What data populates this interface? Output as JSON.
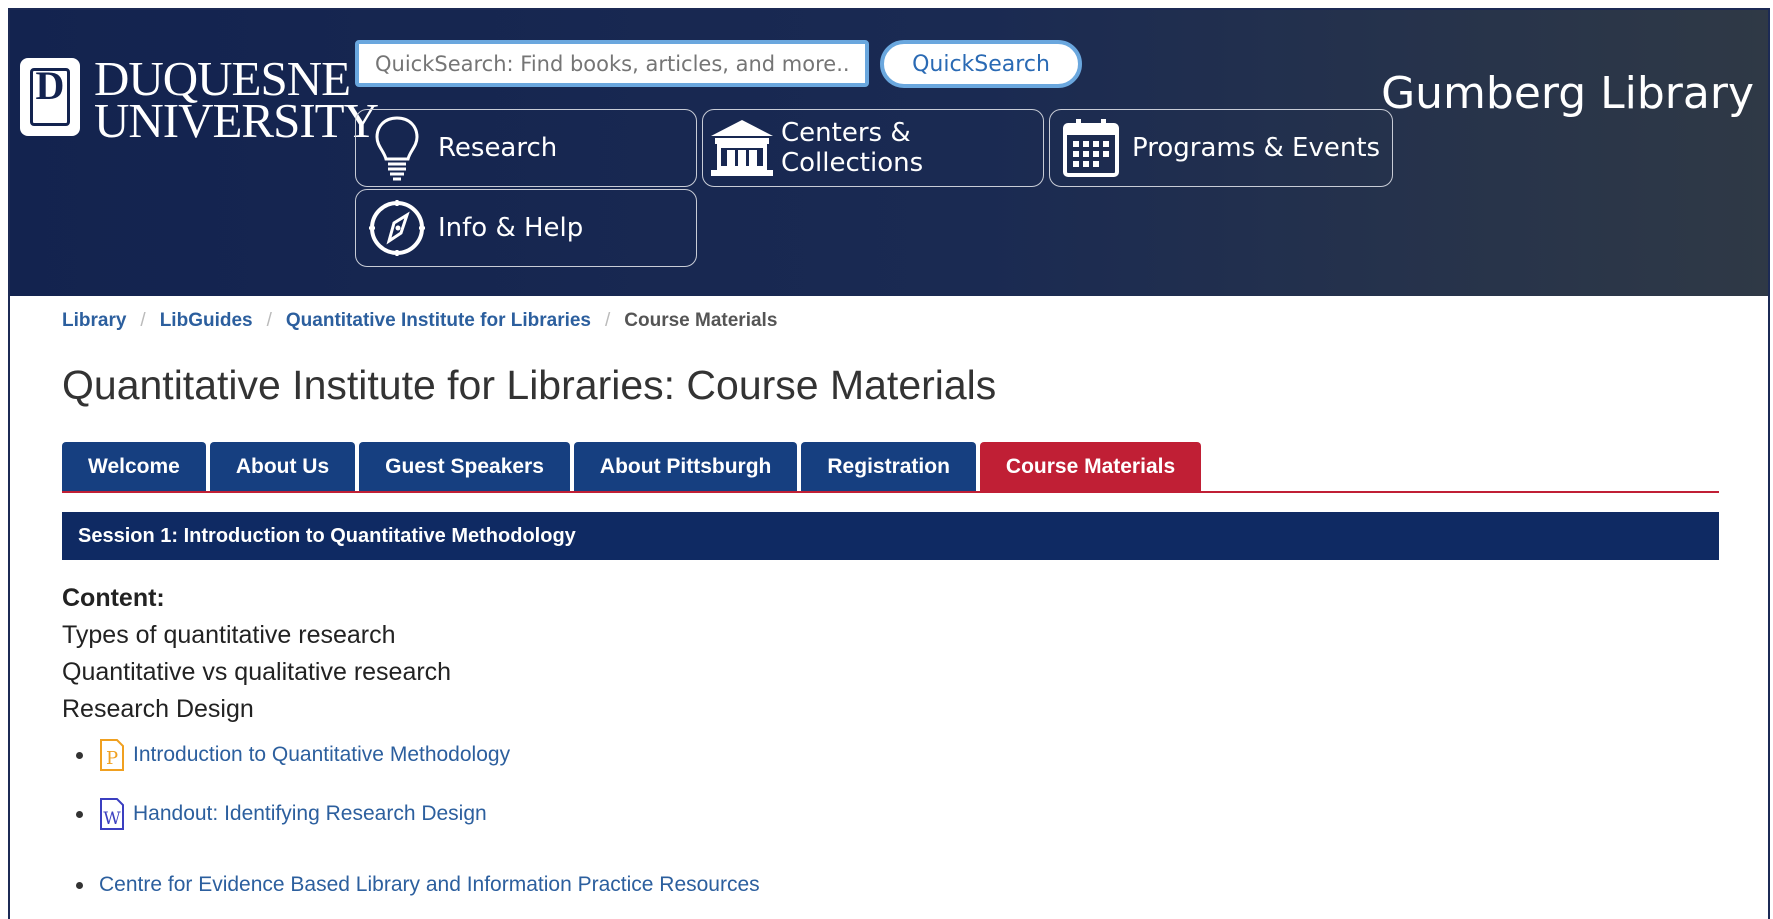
{
  "header": {
    "logo_text_line1": "DUQUESNE",
    "logo_text_line2": "UNIVERSITY",
    "logo_letter": "D",
    "search": {
      "placeholder": "QuickSearch: Find books, articles, and more...",
      "button_label": "QuickSearch"
    },
    "nav": [
      {
        "label": "Research",
        "icon": "lightbulb-icon"
      },
      {
        "label": "Centers & Collections",
        "icon": "building-icon"
      },
      {
        "label": "Programs & Events",
        "icon": "calendar-icon"
      },
      {
        "label": "Info & Help",
        "icon": "compass-icon"
      }
    ],
    "brand": "Gumberg Library"
  },
  "breadcrumb": [
    {
      "label": "Library"
    },
    {
      "label": "LibGuides"
    },
    {
      "label": "Quantitative Institute for Libraries"
    },
    {
      "label": "Course Materials"
    }
  ],
  "page_title": "Quantitative Institute for Libraries: Course Materials",
  "tabs": [
    {
      "label": "Welcome"
    },
    {
      "label": "About Us"
    },
    {
      "label": "Guest Speakers"
    },
    {
      "label": "About Pittsburgh"
    },
    {
      "label": "Registration"
    },
    {
      "label": "Course Materials",
      "active": true
    }
  ],
  "session": {
    "title": "Session 1: Introduction to Quantitative Methodology",
    "content_label": "Content:",
    "content_lines": [
      "Types of quantitative research",
      "Quantitative vs qualitative research",
      "Research Design"
    ],
    "links": [
      {
        "label": "Introduction to Quantitative Methodology",
        "icon": "powerpoint-file-icon"
      },
      {
        "label": "Handout: Identifying Research Design",
        "icon": "word-file-icon"
      },
      {
        "label": "Centre for Evidence Based Library and Information Practice Resources",
        "icon": ""
      }
    ]
  },
  "colors": {
    "header_bg": "#13234f",
    "tab": "#163f80",
    "tab_active": "#c01f35",
    "session_bar": "#0f2a63",
    "link": "#2c5f9e"
  }
}
